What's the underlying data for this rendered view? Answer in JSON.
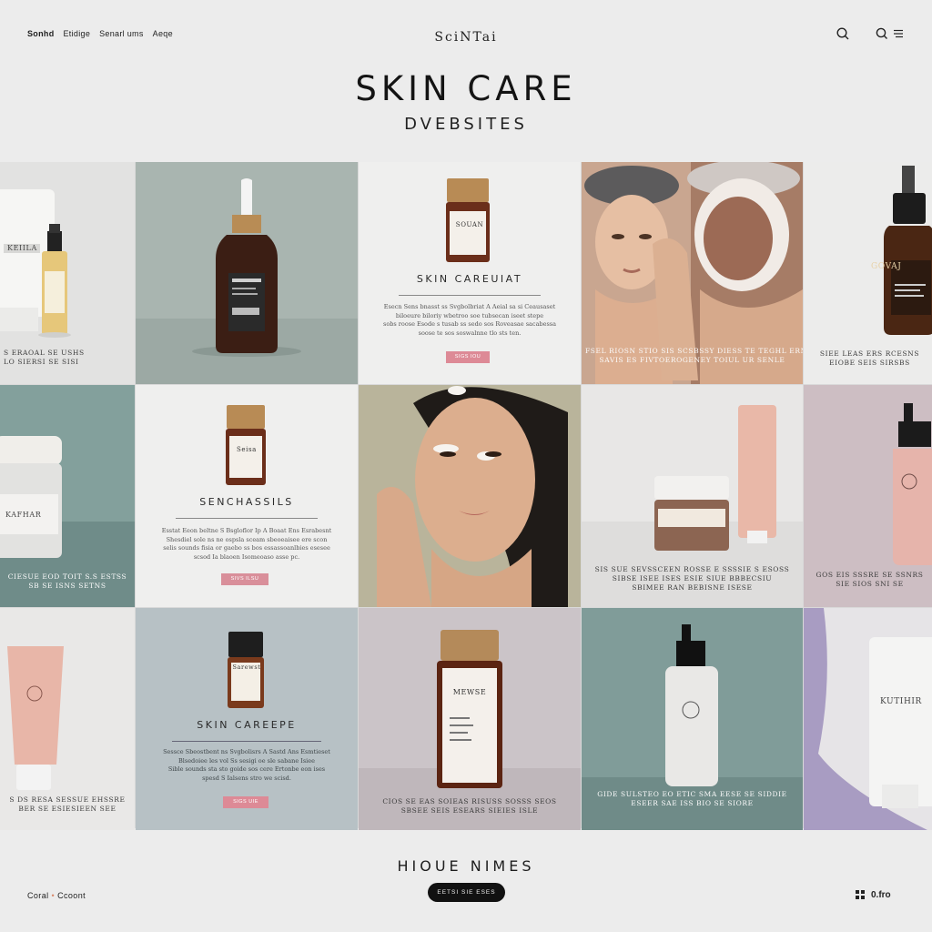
{
  "header": {
    "nav": [
      "Sonhd",
      "Etidige",
      "Senarl ums",
      "Aeqe"
    ],
    "brand": "SciNTai",
    "title": "SKIN CARE",
    "subtitle": "DVEBSITES",
    "icons": [
      "search-icon",
      "search-menu-icon"
    ]
  },
  "grid": {
    "r1c1": {
      "caption": "S ERAOAL SE USHS\nLO SIERSI SE SISI",
      "label": "KEIILA"
    },
    "r1c2": {
      "label": ""
    },
    "r1c3": {
      "heading": "SKIN CAREUIAT",
      "text": "Esecn Sens bnasst ss Svgbolbriat A Aeial sa si Ceausaset\nbiloeure biloriy wbetroo soe tubsecan iseet stepe\nsobs roose Esode s tusab ss sedo sos Roveasae sacabessa\nsoose te sos soswalnne tlo sts ten.",
      "button": "SIGS IOU",
      "bottle_label": "SOUAN"
    },
    "r1c4": {
      "caption": "FSEL RIOSN STIO SIS SCSBSSY DIESS TE TEGHL ERNT\nSAVIS ES FIVTOEROGENEY TOIUL UR SENLE"
    },
    "r1c5": {
      "caption": "SIEE LEAS ERS RCESNS\nEIOBE SEIS SIRSBS",
      "label": "GOVAJ"
    },
    "r2c1": {
      "caption": "CIESUE EOD TOIT S.S ESTSS\nSB SE ISNS SETNS",
      "label": "KAFHAR"
    },
    "r2c2": {
      "heading": "SENCHASSILS",
      "text": "Esstat Eeon beltne S Bsgloflor Ip A Boaat Ens Esrabesnt\nShesdiel sole ns ne ospsla sceam sbeoeaisee ere scon\nselis sounds fisia or gaebo ss bos essassoanlbies esesee\nscsod Ia blaoen Isomeoaso asse pc.",
      "button": "SIVS ILSU",
      "bottle_label": "Seisa"
    },
    "r2c3": {
      "label": ""
    },
    "r2c4": {
      "caption": "SIS SUE SEVSSCEEN ROSSE E SSSSIE S ESOSS\nSIBSE ISEE ISES ESIE SIUE BBBECSIU\nSBIMEE RAN BEBISNE ISESE"
    },
    "r2c5": {
      "caption": "GOS EIS SSSRE SE SSNRS\nSIE SIOS SNI SE"
    },
    "r3c1": {
      "caption": "S DS RESA SESSUE EHSSRE\nBER SE ESIESIEEN SEE"
    },
    "r3c2": {
      "heading": "SKIN CAREEPE",
      "text": "Sessce Sbeostbent ns Svgbolisrs A Sastd Ans Esmtieset\nBlsedoiee les vol Ss sesigi oe sle sabane Isiee\nSible sounds sta sto goide sos cere Ertonbe eon ises\nspesd S Ialsens stro we scisd.",
      "button": "SIGS UIE",
      "bottle_label": "Sarewst"
    },
    "r3c3": {
      "caption": "CIOS SE EAS SOIEAS RISUSS SOSSS SEOS\nSBSEE SEIS ESEARS SIEIES ISLE",
      "label": "MEWSE"
    },
    "r3c4": {
      "caption": "GIDE SULSTEO EO ETIC SMA EESE SE SIDDIE\nESEER SAE ISS BIO SE SIORE"
    },
    "r3c5": {
      "label": "KUTIHIR"
    }
  },
  "footer": {
    "title": "HIOUE NIMES",
    "cta": "EETSI SIE ESES",
    "left": "Coral",
    "left2": "Ccoont",
    "right": "0.fro"
  }
}
